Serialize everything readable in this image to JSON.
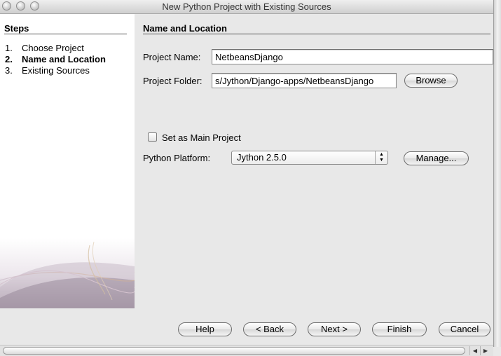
{
  "window": {
    "title": "New Python Project with Existing Sources"
  },
  "steps": {
    "heading": "Steps",
    "items": [
      {
        "num": "1.",
        "label": "Choose Project"
      },
      {
        "num": "2.",
        "label": "Name and Location"
      },
      {
        "num": "3.",
        "label": "Existing Sources"
      }
    ],
    "current_index": 1
  },
  "form": {
    "section_title": "Name and Location",
    "project_name_label": "Project Name:",
    "project_name_value": "NetbeansDjango",
    "project_folder_label": "Project Folder:",
    "project_folder_value": "s/Jython/Django-apps/NetbeansDjango",
    "browse_label": "Browse",
    "main_project_label": "Set as Main Project",
    "main_project_checked": false,
    "platform_label": "Python Platform:",
    "platform_value": "Jython 2.5.0",
    "manage_label": "Manage..."
  },
  "buttons": {
    "help": "Help",
    "back": "< Back",
    "next": "Next >",
    "finish": "Finish",
    "cancel": "Cancel"
  },
  "icons": {
    "window_controls": [
      "close-icon",
      "minimize-icon",
      "zoom-icon"
    ],
    "select_arrows": "up-down-arrows-icon",
    "scroll_left": "arrow-left-icon",
    "scroll_right": "arrow-right-icon"
  }
}
